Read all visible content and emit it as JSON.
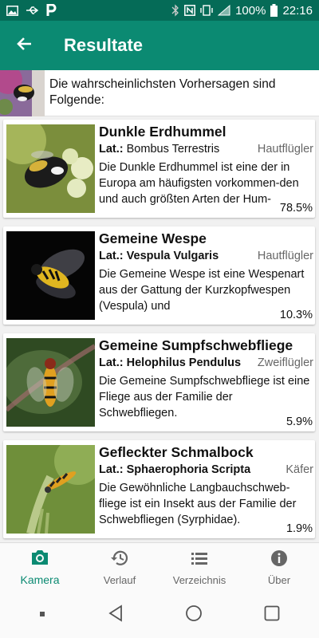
{
  "status_bar": {
    "battery": "100%",
    "time": "22:16",
    "icons": [
      "image-icon",
      "usb-icon",
      "p-app-icon",
      "bluetooth-icon",
      "nfc-icon",
      "vibrate-icon",
      "signal-icon",
      "battery-icon"
    ]
  },
  "app_bar": {
    "title": "Resultate",
    "back_icon": "arrow-left-icon"
  },
  "intro": {
    "text": "Die wahrscheinlichsten Vorhersagen sind Folgende:"
  },
  "results": [
    {
      "name": "Dunkle Erdhummel",
      "lat_label": "Lat.:",
      "latin": "Bombus Terrestris",
      "order": "Hautflügler",
      "description": "Die Dunkle Erdhummel ist eine der in Europa am häufigsten vorkommen-den und auch größten Arten der Hum-",
      "probability": "78.5%"
    },
    {
      "name": "Gemeine Wespe",
      "lat_label": "Lat.:",
      "latin": "Vespula Vulgaris",
      "order": "Hautflügler",
      "description": "Die Gemeine Wespe ist eine Wespenart aus der Gattung der Kurzkopfwespen (Vespula) und",
      "probability": "10.3%"
    },
    {
      "name": "Gemeine Sumpfschwebfliege",
      "lat_label": "Lat.:",
      "latin": "Helophilus Pendulus",
      "order": "Zweiflügler",
      "description": "Die Gemeine Sumpfschwebfliege ist eine Fliege aus der Familie der Schwebfliegen.",
      "probability": "5.9%"
    },
    {
      "name": "Gefleckter Schmalbock",
      "lat_label": "Lat.:",
      "latin": "Sphaerophoria Scripta",
      "order": "Käfer",
      "description": "Die Gewöhnliche Langbauchschweb-fliege ist ein Insekt aus der Familie der Schwebfliegen (Syrphidae).",
      "probability": "1.9%"
    }
  ],
  "bottom_nav": [
    {
      "label": "Kamera",
      "icon": "camera-icon",
      "active": true
    },
    {
      "label": "Verlauf",
      "icon": "history-icon",
      "active": false
    },
    {
      "label": "Verzeichnis",
      "icon": "list-icon",
      "active": false
    },
    {
      "label": "Über",
      "icon": "info-icon",
      "active": false
    }
  ],
  "system_nav": [
    "recent-apps-dot-icon",
    "back-triangle-icon",
    "home-circle-icon",
    "overview-square-icon"
  ],
  "colors": {
    "primary": "#0b8a72",
    "primary_dark": "#056b57",
    "active_tab": "#0b8a72"
  }
}
